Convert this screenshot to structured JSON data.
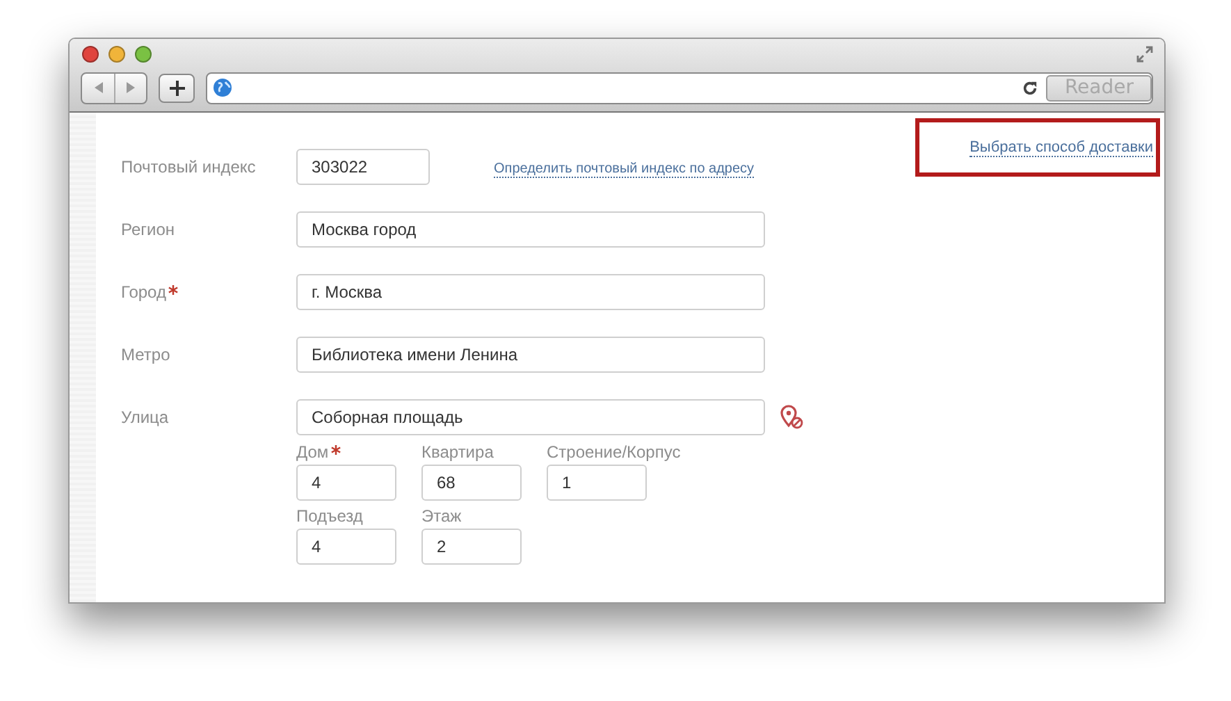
{
  "toolbar": {
    "reader_button": "Reader"
  },
  "delivery_link": {
    "label": "Выбрать способ доставки",
    "highlighted": true
  },
  "postal": {
    "label": "Почтовый индекс",
    "value": "303022",
    "required": false,
    "link": "Определить почтовый индекс по адресу"
  },
  "fields": [
    {
      "label": "Регион",
      "value": "Москва город",
      "required": false
    },
    {
      "label": "Город",
      "value": "г. Москва",
      "required": true
    },
    {
      "label": "Метро",
      "value": "Библиотека имени Ленина",
      "required": false
    },
    {
      "label": "Улица",
      "value": "Соборная площадь",
      "required": false
    }
  ],
  "address_rows": [
    [
      {
        "label": "Дом",
        "value": "4",
        "required": true
      },
      {
        "label": "Квартира",
        "value": "68",
        "required": false
      },
      {
        "label": "Строение/Корпус",
        "value": "1",
        "required": false
      }
    ],
    [
      {
        "label": "Подъезд",
        "value": "4",
        "required": false
      },
      {
        "label": "Этаж",
        "value": "2",
        "required": false
      }
    ]
  ]
}
